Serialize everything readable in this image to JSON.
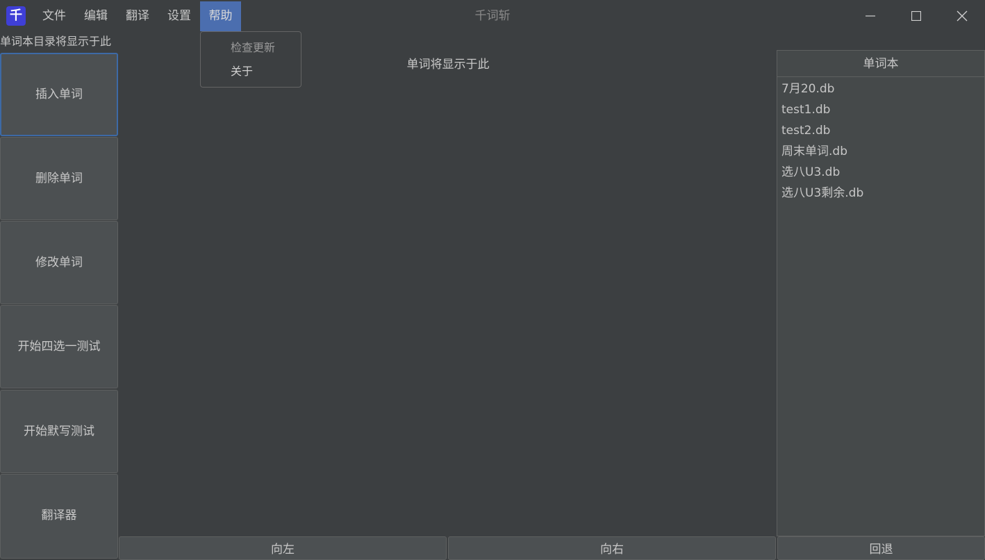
{
  "app": {
    "icon_glyph": "千",
    "window_title": "千词斩"
  },
  "menubar": {
    "items": [
      "文件",
      "编辑",
      "翻译",
      "设置",
      "帮助"
    ],
    "active_item": "帮助"
  },
  "help_menu": {
    "items": [
      "检查更新",
      "关于"
    ]
  },
  "window_controls": {
    "minimize_glyph": "—",
    "maximize_glyph": "☐",
    "close_glyph": "✕"
  },
  "left": {
    "wordbook_dir_label": "单词本目录将显示于此",
    "buttons": [
      "插入单词",
      "删除单词",
      "修改单词",
      "开始四选一测试",
      "开始默写测试",
      "翻译器"
    ]
  },
  "center": {
    "word_placeholder": "单词将显示于此"
  },
  "wordbook_panel": {
    "header": "单词本",
    "items": [
      "7月20.db",
      "test1.db",
      "test2.db",
      "周末单词.db",
      "选八U3.db",
      "选八U3剩余.db"
    ]
  },
  "bottom": {
    "left_button": "向左",
    "right_button": "向右",
    "back_button": "回退"
  },
  "colors": {
    "background": "#3c3f41",
    "menu_active": "#4b6eaf",
    "focus_border": "#3d6aa6",
    "button_bg": "#4c5052"
  }
}
